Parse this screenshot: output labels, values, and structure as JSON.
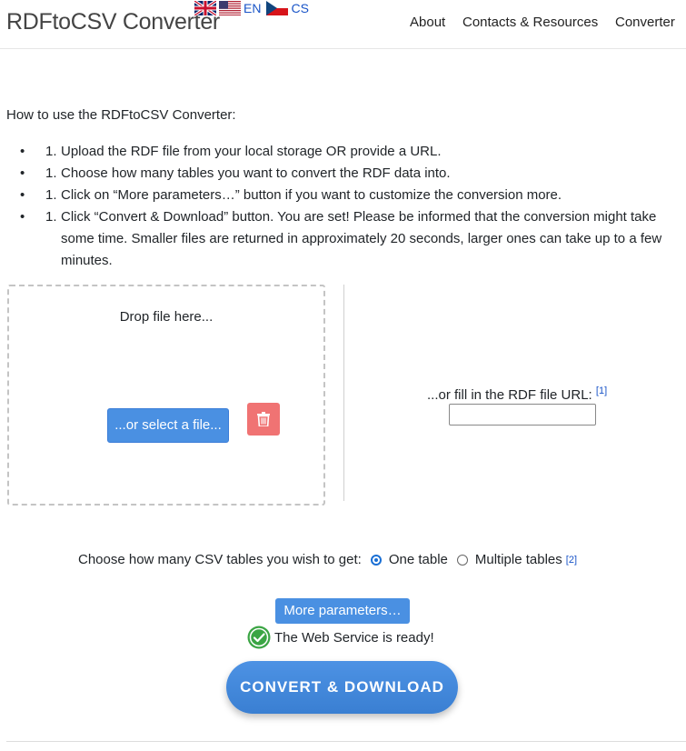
{
  "header": {
    "brand": "RDFtoCSV Converter",
    "languages": [
      {
        "code": "EN",
        "flags": [
          "uk-flag-icon",
          "us-flag-icon"
        ]
      },
      {
        "code": "CS",
        "flags": [
          "czech-flag-icon"
        ]
      }
    ],
    "nav": [
      "About",
      "Contacts & Resources",
      "Converter"
    ]
  },
  "instructions": {
    "intro": "How to use the RDFtoCSV Converter:",
    "steps": [
      "Upload the RDF file from your local storage OR provide a URL.",
      "Choose how many tables you want to convert the RDF data into.",
      "Click on “More parameters…” button if you want to customize the conversion more.",
      "Click “Convert & Download” button. You are set! Please be informed that the conversion might take some time. Smaller files are returned in approximately 20 seconds, larger ones can take up to a few minutes."
    ],
    "step_number": "1."
  },
  "upload": {
    "drop_text": "Drop file here...",
    "select_button": "...or select a file...",
    "url_label": "...or fill in the RDF file URL:",
    "url_ref": "[1]",
    "url_value": ""
  },
  "tables_choice": {
    "label": "Choose how many CSV tables you wish to get:",
    "options": [
      {
        "label": "One table",
        "checked": true
      },
      {
        "label": "Multiple tables",
        "checked": false
      }
    ],
    "ref": "[2]"
  },
  "more_parameters_button": "More parameters…",
  "status_text": "The Web Service is ready!",
  "convert_button": "CONVERT & DOWNLOAD",
  "colors": {
    "primary_button": "#4a90e2",
    "delete_button": "#f07373",
    "status_ok": "#3ba544",
    "link": "#1a55c8"
  }
}
